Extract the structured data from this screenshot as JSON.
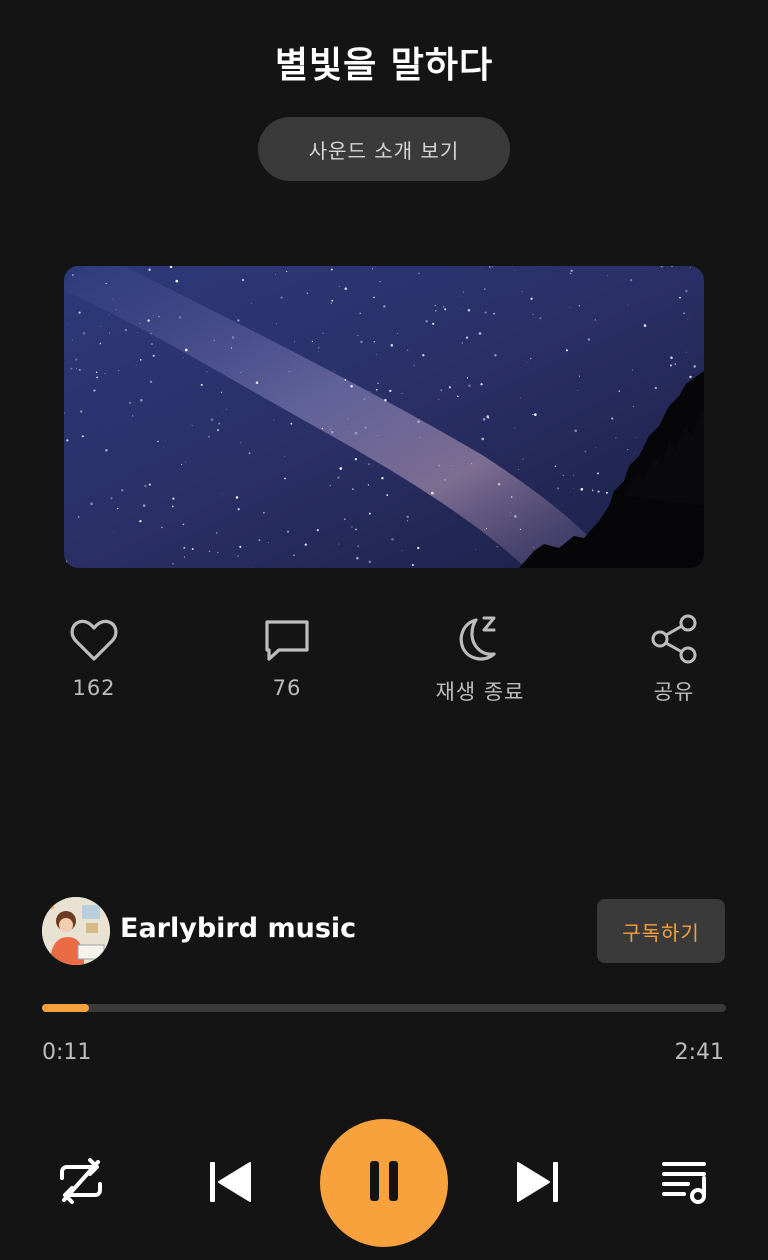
{
  "header": {
    "title": "별빛을 말하다",
    "sound_intro_label": "사운드 소개 보기"
  },
  "artwork": {
    "description_icon": "night-sky-milky-way-image"
  },
  "actions": [
    {
      "icon": "heart-icon",
      "label": "162"
    },
    {
      "icon": "comment-icon",
      "label": "76"
    },
    {
      "icon": "moon-sleep-icon",
      "label": "재생 종료"
    },
    {
      "icon": "share-icon",
      "label": "공유"
    }
  ],
  "channel": {
    "name": "Earlybird music",
    "subscribe_label": "구독하기"
  },
  "player": {
    "progress": 0.068,
    "current_time": "0:11",
    "total_time": "2:41"
  },
  "controls": {
    "repeat_icon": "repeat-off-icon",
    "prev_icon": "skip-previous-icon",
    "play_icon": "pause-icon",
    "next_icon": "skip-next-icon",
    "playlist_icon": "playlist-icon"
  },
  "colors": {
    "background": "#141414",
    "accent": "#f5a03c",
    "surface": "#3a3a3a"
  }
}
